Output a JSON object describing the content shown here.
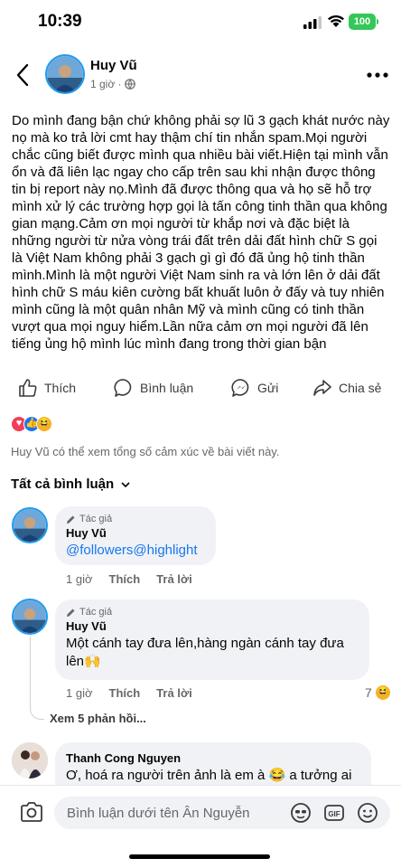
{
  "status_bar": {
    "time": "10:39",
    "battery": "100"
  },
  "post": {
    "author": "Huy Vũ",
    "time": "1 giờ ·",
    "body": "Do mình đang bận chứ không phải sợ lũ 3 gạch khát nước này nọ mà ko trả lời cmt hay thậm chí tin nhắn spam.Mọi người chắc cũng biết được mình qua nhiều bài viết.Hiện tại mình vẫn ổn và đã liên lạc ngay cho cấp trên sau khi nhận được thông tin bị report này nọ.Mình đã được thông qua và họ sẽ hỗ trợ mình xử lý các trường hợp gọi là tấn công tinh thần qua không gian mạng.Cảm ơn mọi người từ khắp nơi và đặc biệt là những người từ nửa vòng trái đất trên dải đất hình chữ S gọi là Việt Nam không phải 3 gạch gì gì đó đã ủng hộ tinh thần mình.Mình là một người  Việt Nam sinh ra và lớn lên ở dải đất hình chữ S máu kiên cường bất khuất luôn ở đấy và tuy nhiên mình cũng là một quân nhân Mỹ và mình cũng có tinh thần vượt qua mọi nguy hiểm.Lần nữa cảm ơn mọi người đã lên tiếng ủng hộ mình lúc mình đang trong thời gian bận"
  },
  "actions": {
    "like": "Thích",
    "comment": "Bình luận",
    "send": "Gửi",
    "share": "Chia sẻ"
  },
  "reactions": {
    "note": "Huy Vũ có thể xem tổng số cảm xúc về bài viết này."
  },
  "comments_header": "Tất cả bình luận",
  "comments": [
    {
      "tag": "Tác giả",
      "name": "Huy Vũ",
      "text": "@followers@highlight",
      "time": "1 giờ",
      "like": "Thích",
      "reply": "Trả lời"
    },
    {
      "tag": "Tác giả",
      "name": "Huy Vũ",
      "text": "Một cánh tay đưa lên,hàng ngàn cánh tay đưa lên🙌",
      "time": "1 giờ",
      "like": "Thích",
      "reply": "Trả lời",
      "reaction_count": "7"
    },
    {
      "name": "Thanh Cong Nguyen",
      "text": "Ơ, hoá ra người trên ảnh là em à 😂 a tưởng ai"
    }
  ],
  "view_replies": "Xem 5 phản hồi...",
  "composer": {
    "placeholder": "Bình luận dưới tên Ân Nguyễn"
  },
  "colors": {
    "accent": "#1877f2",
    "secondary_text": "#65676b",
    "bubble": "#f0f2f5",
    "battery": "#34c759"
  }
}
